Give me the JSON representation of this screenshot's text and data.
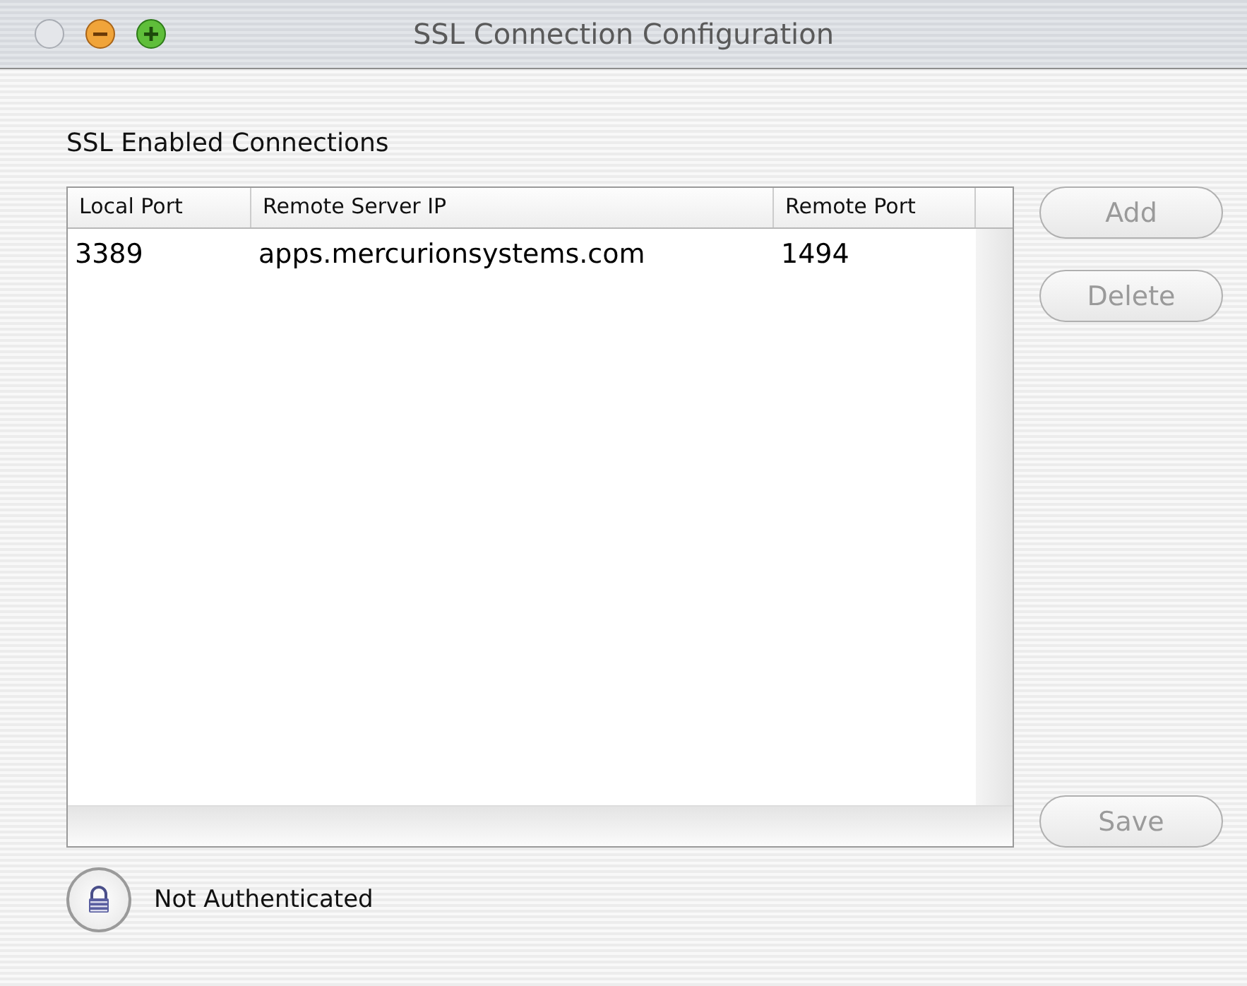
{
  "window": {
    "title": "SSL Connection Configuration"
  },
  "section_title": "SSL Enabled Connections",
  "table": {
    "columns": [
      "Local Port",
      "Remote Server IP",
      "Remote Port"
    ],
    "rows": [
      {
        "cells": [
          "3389",
          "apps.mercurionsystems.com",
          "1494"
        ],
        "selected": false
      }
    ]
  },
  "buttons": [
    {
      "label": "Add",
      "disabled": true
    },
    {
      "label": "Delete",
      "disabled": true
    },
    {
      "label": "Save",
      "disabled": true
    }
  ],
  "status": {
    "text": "Not Authenticated",
    "locked": true
  }
}
